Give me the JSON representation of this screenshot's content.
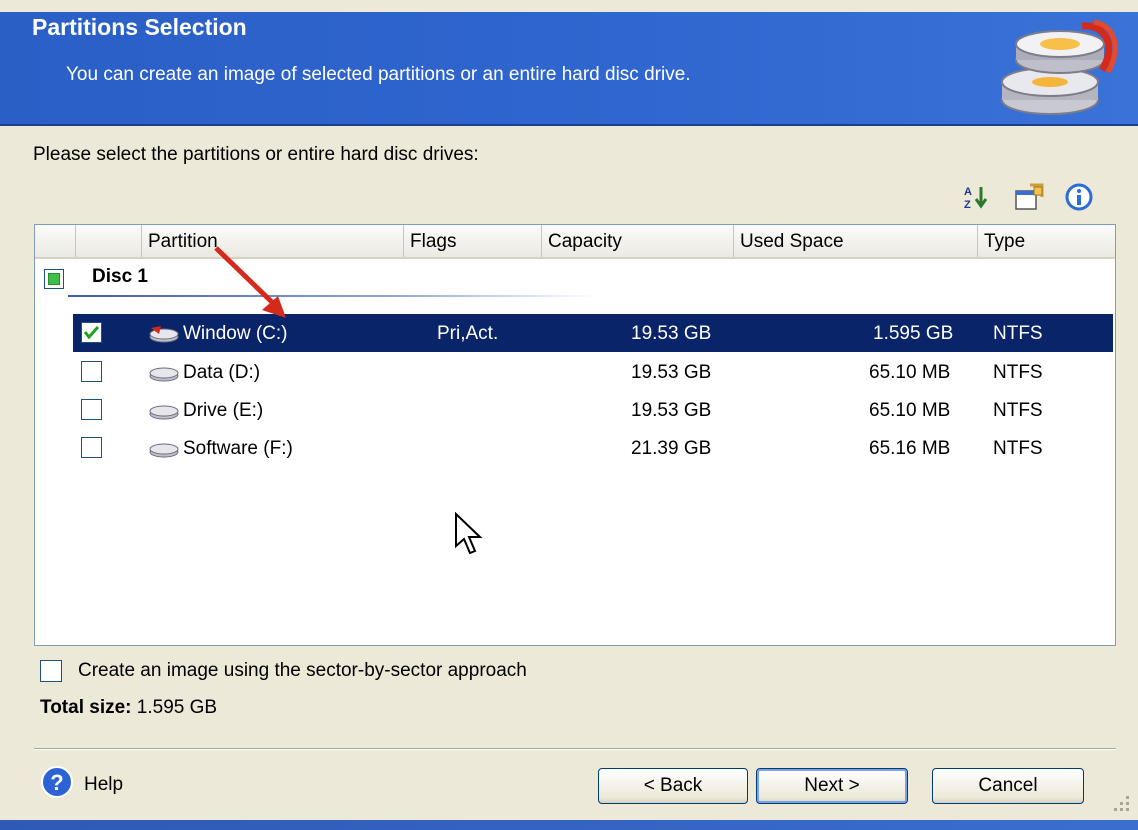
{
  "banner": {
    "title": "Partitions Selection",
    "subtitle": "You can create an image of selected partitions or an entire hard disc drive."
  },
  "instruction": "Please select the partitions or entire hard disc drives:",
  "toolbar": {
    "icons": [
      "sort-icon",
      "properties-icon",
      "info-icon"
    ]
  },
  "columns": [
    "Partition",
    "Flags",
    "Capacity",
    "Used Space",
    "Type"
  ],
  "disc": {
    "label": "Disc 1",
    "state": "partial"
  },
  "partitions": [
    {
      "name": "Window (C:)",
      "flags": "Pri,Act.",
      "capacity": "19.53 GB",
      "used": "1.595 GB",
      "type": "NTFS",
      "checked": true
    },
    {
      "name": "Data (D:)",
      "flags": "",
      "capacity": "19.53 GB",
      "used": "65.10 MB",
      "type": "NTFS",
      "checked": false
    },
    {
      "name": "Drive (E:)",
      "flags": "",
      "capacity": "19.53 GB",
      "used": "65.10 MB",
      "type": "NTFS",
      "checked": false
    },
    {
      "name": "Software (F:)",
      "flags": "",
      "capacity": "21.39 GB",
      "used": "65.16 MB",
      "type": "NTFS",
      "checked": false
    }
  ],
  "sector_option": {
    "label": "Create an image using the sector-by-sector approach",
    "checked": false
  },
  "total": {
    "label": "Total size:",
    "value": "1.595 GB"
  },
  "footer": {
    "help": "Help",
    "back": "< Back",
    "next": "Next >",
    "cancel": "Cancel"
  },
  "colors": {
    "banner": "#2f66cf",
    "selection": "#0a246a",
    "annotation_arrow": "#d42a1c"
  }
}
